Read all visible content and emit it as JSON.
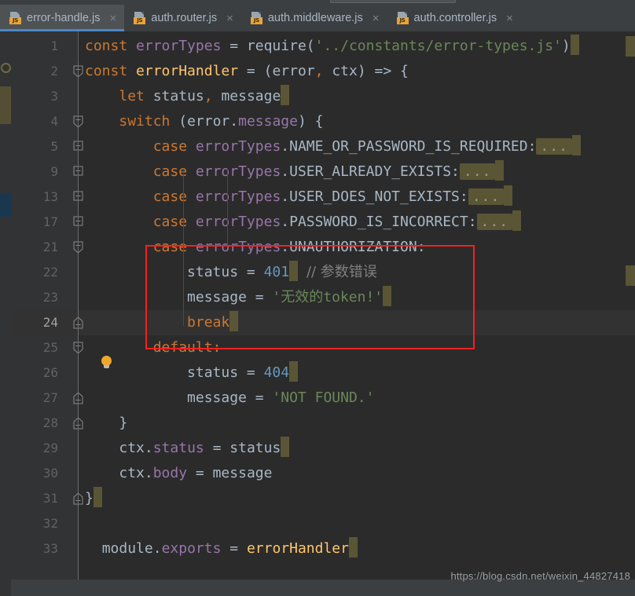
{
  "window": {
    "theme_bg": "#2b2b2b",
    "chrome_bg": "#3c3f41",
    "accent": "#4a88c7",
    "selection_box_color": "#f52020"
  },
  "tabs": [
    {
      "label": "error-handle.js",
      "icon": "js-file-icon",
      "close": "×",
      "active": true
    },
    {
      "label": "auth.router.js",
      "icon": "js-file-icon",
      "close": "×",
      "active": false
    },
    {
      "label": "auth.middleware.js",
      "icon": "js-file-icon",
      "close": "×",
      "active": false
    },
    {
      "label": "auth.controller.js",
      "icon": "js-file-icon",
      "close": "×",
      "active": false
    }
  ],
  "tab_icon_label": "JS",
  "editor": {
    "current_line": "24",
    "lines": [
      {
        "n": "1",
        "indent": 0,
        "fold": "",
        "current": false
      },
      {
        "n": "2",
        "indent": 0,
        "fold": "minus",
        "current": false
      },
      {
        "n": "3",
        "indent": 0,
        "fold": "",
        "current": false
      },
      {
        "n": "4",
        "indent": 0,
        "fold": "minus",
        "current": false
      },
      {
        "n": "5",
        "indent": 0,
        "fold": "plus",
        "current": false
      },
      {
        "n": "9",
        "indent": 0,
        "fold": "plus",
        "current": false
      },
      {
        "n": "13",
        "indent": 0,
        "fold": "plus",
        "current": false
      },
      {
        "n": "17",
        "indent": 0,
        "fold": "plus",
        "current": false
      },
      {
        "n": "21",
        "indent": 0,
        "fold": "minus",
        "current": false
      },
      {
        "n": "22",
        "indent": 0,
        "fold": "",
        "current": false
      },
      {
        "n": "23",
        "indent": 0,
        "fold": "",
        "current": false
      },
      {
        "n": "24",
        "indent": 0,
        "fold": "end",
        "current": true
      },
      {
        "n": "25",
        "indent": 0,
        "fold": "minus",
        "current": false
      },
      {
        "n": "26",
        "indent": 0,
        "fold": "",
        "current": false
      },
      {
        "n": "27",
        "indent": 0,
        "fold": "end",
        "current": false
      },
      {
        "n": "28",
        "indent": 0,
        "fold": "end",
        "current": false
      },
      {
        "n": "29",
        "indent": 0,
        "fold": "",
        "current": false
      },
      {
        "n": "30",
        "indent": 0,
        "fold": "",
        "current": false
      },
      {
        "n": "31",
        "indent": 0,
        "fold": "end",
        "current": false
      },
      {
        "n": "32",
        "indent": 0,
        "fold": "",
        "current": false
      },
      {
        "n": "33",
        "indent": 0,
        "fold": "",
        "current": false
      }
    ],
    "code": {
      "l1": "const errorTypes = require('../constants/error-types.js')",
      "l2": "const errorHandler = (error, ctx) => {",
      "l3": "    let status, message",
      "l4": "    switch (error.message) {",
      "l5": "        case errorTypes.NAME_OR_PASSWORD_IS_REQUIRED:...",
      "l9": "        case errorTypes.USER_ALREADY_EXISTS:...",
      "l13": "        case errorTypes.USER_DOES_NOT_EXISTS:...",
      "l17": "        case errorTypes.PASSWORD_IS_INCORRECT:...",
      "l21": "        case errorTypes.UNAUTHORIZATION:",
      "l22": "            status = 401 // 参数错误",
      "l23": "            message = '无效的token!'",
      "l24": "            break",
      "l25": "        default:",
      "l26": "            status = 404",
      "l27": "            message = 'NOT FOUND.'",
      "l28": "    }",
      "l29": "    ctx.status = status",
      "l30": "    ctx.body = message",
      "l31": "}",
      "l32": "",
      "l33": "  module.exports = errorHandler",
      "fold_placeholder": "..."
    },
    "tokens": {
      "kw_const": "const",
      "kw_let": "let",
      "kw_switch": "switch",
      "kw_case": "case",
      "kw_break": "break",
      "kw_default": "default:",
      "id_errorTypes": "errorTypes",
      "id_errorHandler": "errorHandler",
      "id_require": "require",
      "str_require_path": "'../constants/error-types.js'",
      "id_error": "error",
      "id_ctx": "ctx",
      "id_status": "status",
      "id_message": "message",
      "c_NAME_OR_PASSWORD_IS_REQUIRED": "NAME_OR_PASSWORD_IS_REQUIRED",
      "c_USER_ALREADY_EXISTS": "USER_ALREADY_EXISTS",
      "c_USER_DOES_NOT_EXISTS": "USER_DOES_NOT_EXISTS",
      "c_PASSWORD_IS_INCORRECT": "PASSWORD_IS_INCORRECT",
      "c_UNAUTHORIZATION": "UNAUTHORIZATION",
      "num_401": "401",
      "num_404": "404",
      "comment_cn": "// 参数错误",
      "str_token_cn": "'无效的token!'",
      "str_not_found": "'NOT FOUND.'",
      "id_module": "module",
      "id_exports": "exports",
      "id_body": "body"
    },
    "hint": {
      "icon": "lightbulb-icon",
      "line": "24"
    }
  },
  "watermark": "https://blog.csdn.net/weixin_44827418"
}
